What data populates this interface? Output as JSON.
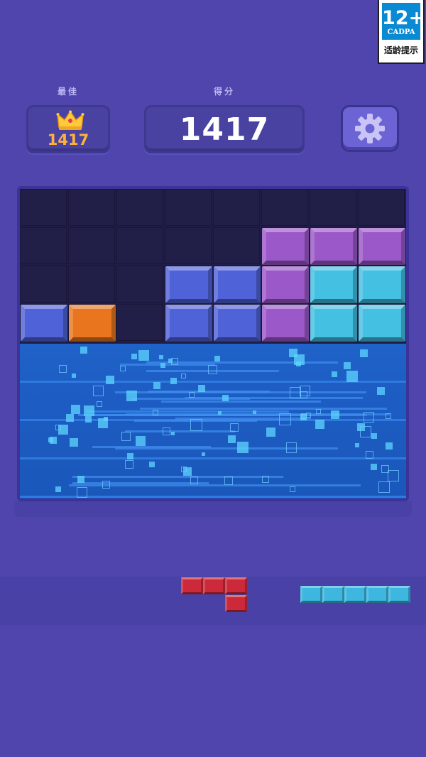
{
  "age_badge": {
    "rating": "12+",
    "org": "CADPA",
    "hint": "适龄提示"
  },
  "best": {
    "label": "最佳",
    "value": "1417"
  },
  "score": {
    "label": "得分",
    "value": "1417"
  },
  "icons": {
    "crown": "crown-icon",
    "settings": "gear-icon"
  },
  "board": {
    "columns": 8,
    "rows": 8,
    "colors": {
      "purple": "#9b58c8",
      "blue": "#4f62d8",
      "cyan": "#44c0e2",
      "orange": "#e9761f",
      "red": "#cc2a3a",
      "cyan_piece": "#3db6e0"
    },
    "filled_cells": [
      {
        "row": 1,
        "col": 5,
        "color": "purple"
      },
      {
        "row": 1,
        "col": 6,
        "color": "purple"
      },
      {
        "row": 1,
        "col": 7,
        "color": "purple"
      },
      {
        "row": 2,
        "col": 3,
        "color": "blue"
      },
      {
        "row": 2,
        "col": 4,
        "color": "blue"
      },
      {
        "row": 2,
        "col": 5,
        "color": "purple"
      },
      {
        "row": 2,
        "col": 6,
        "color": "cyan"
      },
      {
        "row": 2,
        "col": 7,
        "color": "cyan"
      },
      {
        "row": 3,
        "col": 0,
        "color": "blue"
      },
      {
        "row": 3,
        "col": 1,
        "color": "orange"
      },
      {
        "row": 3,
        "col": 3,
        "color": "blue"
      },
      {
        "row": 3,
        "col": 4,
        "color": "blue"
      },
      {
        "row": 3,
        "col": 5,
        "color": "purple"
      },
      {
        "row": 3,
        "col": 6,
        "color": "cyan"
      },
      {
        "row": 3,
        "col": 7,
        "color": "cyan"
      }
    ],
    "clearing_rows": [
      4,
      5,
      6,
      7
    ]
  },
  "tray": {
    "pieces": [
      {
        "name": "red-piece",
        "color": "red",
        "cells": [
          [
            0,
            0
          ],
          [
            0,
            1
          ],
          [
            0,
            2
          ],
          [
            1,
            2
          ]
        ]
      },
      {
        "name": "cyan-piece",
        "color": "cyan_piece",
        "cells": [
          [
            0,
            0
          ],
          [
            0,
            1
          ],
          [
            0,
            2
          ],
          [
            0,
            3
          ],
          [
            0,
            4
          ]
        ]
      }
    ]
  }
}
